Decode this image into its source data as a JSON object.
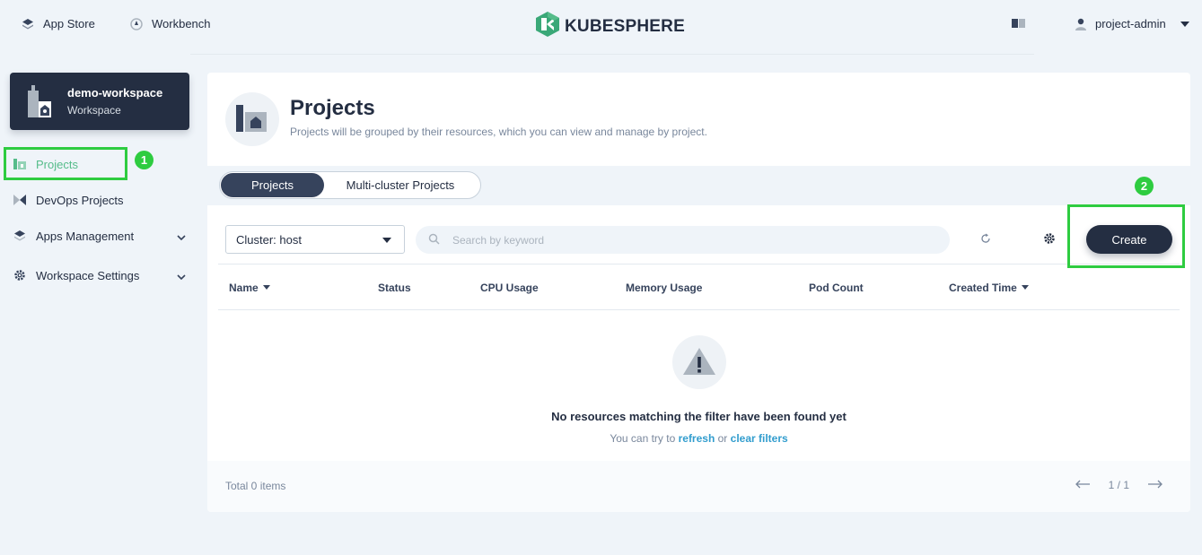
{
  "topbar": {
    "app_store": "App Store",
    "workbench": "Workbench",
    "logo_text": "KUBESPHERE",
    "user": "project-admin"
  },
  "workspace": {
    "name": "demo-workspace",
    "type": "Workspace"
  },
  "sidebar": {
    "items": [
      {
        "label": "Projects",
        "icon": "projects-icon",
        "active": true
      },
      {
        "label": "DevOps Projects",
        "icon": "devops-icon"
      },
      {
        "label": "Apps Management",
        "icon": "apps-icon"
      },
      {
        "label": "Workspace Settings",
        "icon": "settings-icon"
      }
    ]
  },
  "annotations": {
    "step1": "1",
    "step2": "2",
    "highlight_color": "#2ecc40"
  },
  "page": {
    "title": "Projects",
    "description": "Projects will be grouped by their resources, which you can view and manage by project."
  },
  "tabs": [
    "Projects",
    "Multi-cluster Projects"
  ],
  "toolbar": {
    "cluster_select": "Cluster: host",
    "search_placeholder": "Search by keyword",
    "create_label": "Create"
  },
  "table": {
    "columns": [
      "Name",
      "Status",
      "CPU Usage",
      "Memory Usage",
      "Pod Count",
      "Created Time"
    ]
  },
  "empty": {
    "title": "No resources matching the filter have been found yet",
    "hint_prefix": "You can try to",
    "refresh": "refresh",
    "or": "or",
    "clear": "clear filters"
  },
  "footer": {
    "total": "Total 0 items",
    "page": "1 / 1"
  },
  "colors": {
    "accent": "#55bc8a",
    "dark": "#242e42",
    "link": "#329dce"
  }
}
